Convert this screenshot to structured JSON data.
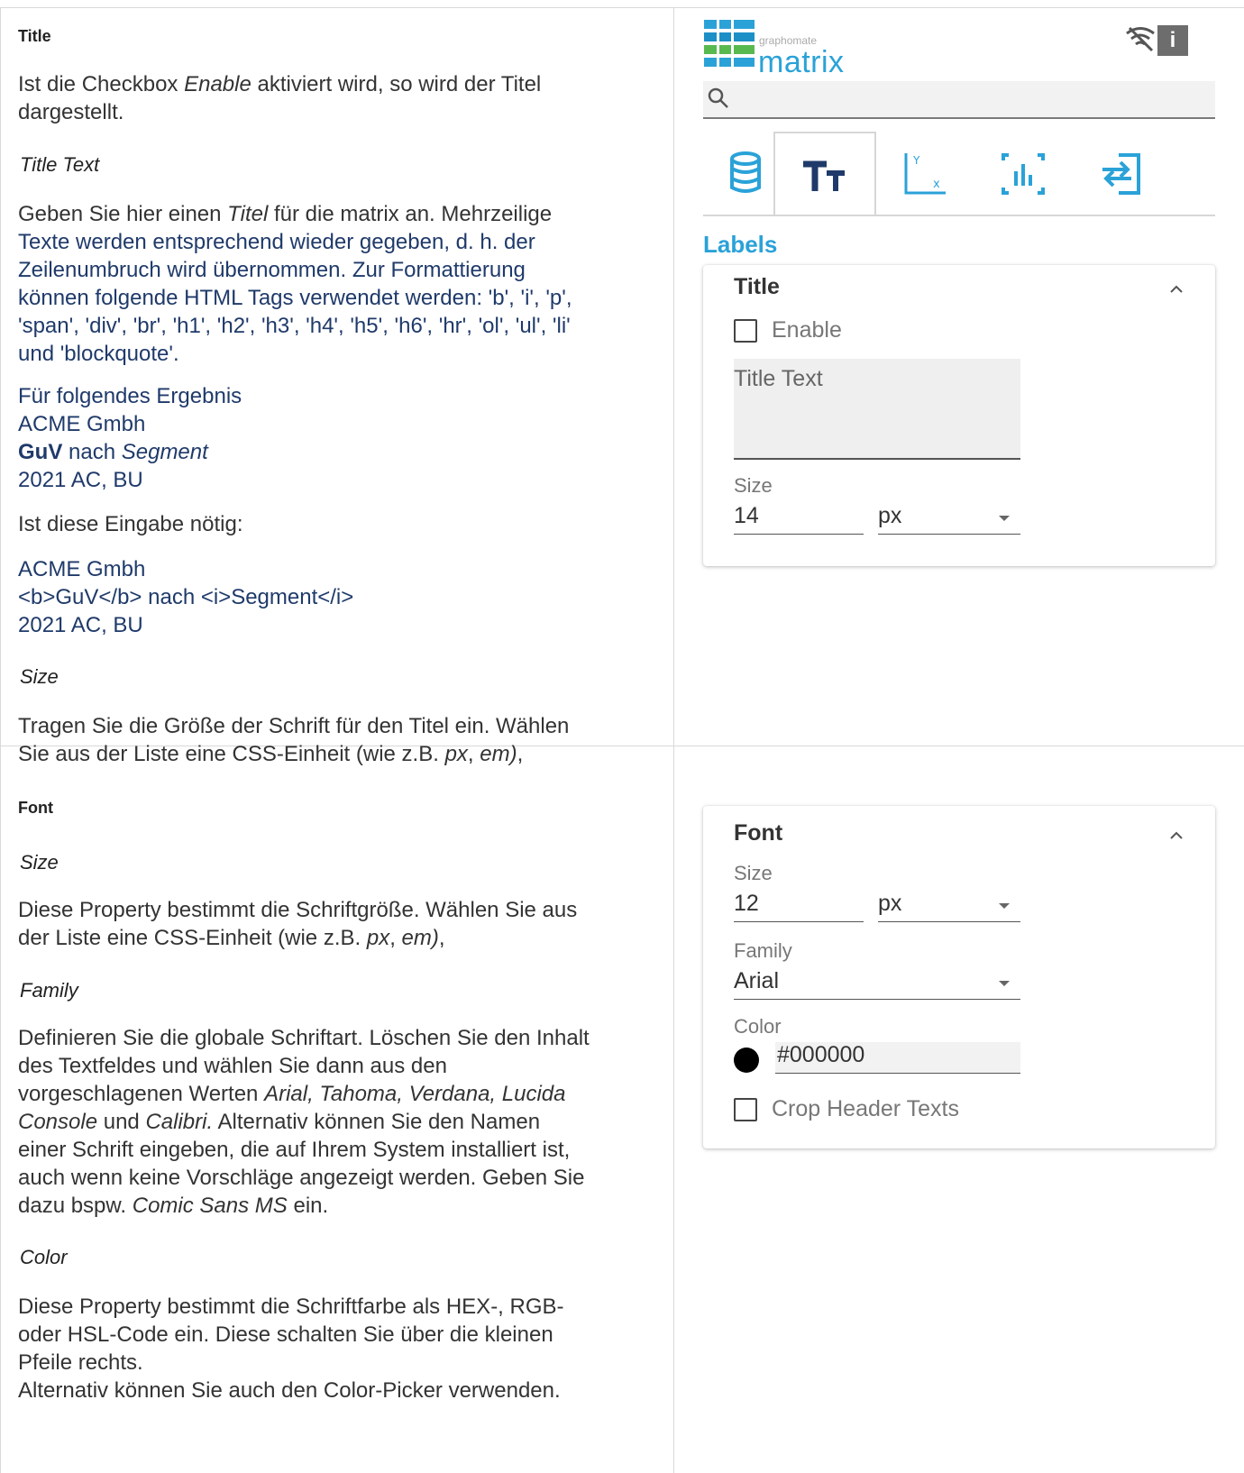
{
  "left_top": {
    "title": "Title",
    "intro": "Ist die Checkbox Enable aktiviert wird, so wird der Titel dargestellt.",
    "intro_parts": [
      "Ist die Checkbox ",
      "Enable",
      " aktiviert wird, so wird der Titel",
      "dargestellt."
    ],
    "title_text_sub": "Title Text",
    "title_text_p1": "Geben Sie hier einen ",
    "title_text_p1_em": "Titel",
    "title_text_p1_b": " für die matrix an. Mehrzeilige",
    "title_text_lines": [
      "Texte werden entsprechend wieder gegeben, d. h. der",
      "Zeilenumbruch wird übernommen. Zur Formattierung",
      "können folgende HTML Tags verwendet werden: 'b', 'i', 'p',",
      "'span', 'div', 'br', 'h1', 'h2', 'h3', 'h4', 'h5', 'h6', 'hr', 'ol', 'ul', 'li'",
      "und 'blockquote'."
    ],
    "example_lines": [
      "Für folgendes Ergebnis",
      "ACME Gmbh"
    ],
    "example_guv": "GuV",
    "example_nach": " nach ",
    "example_segment": "Segment",
    "example_year": "2021 AC, BU",
    "input_needed": "Ist diese Eingabe nötig:",
    "code_lines": [
      "ACME Gmbh",
      "<b>GuV</b> nach <i>Segment</i>",
      "2021 AC, BU"
    ],
    "size_sub": "Size",
    "size_line1": "Tragen Sie die Größe der Schrift für den Titel ein. Wählen",
    "size_line2_a": "Sie aus der Liste eine CSS-Einheit (wie z.B. ",
    "size_line2_px": "px",
    "size_line2_sep": ", ",
    "size_line2_em": "em)",
    "size_line2_end": ","
  },
  "left_bottom": {
    "title": "Font",
    "size_sub": "Size",
    "size_line1": "Diese Property bestimmt die Schriftgröße. Wählen Sie aus",
    "size_line2_a": "der Liste eine CSS-Einheit (wie z.B. ",
    "size_line2_px": "px",
    "size_line2_sep": ", ",
    "size_line2_em": "em)",
    "size_line2_end": ",",
    "family_sub": "Family",
    "family_line1": "Definieren Sie die globale Schriftart. Löschen Sie den Inhalt",
    "family_line2": "des Textfeldes und wählen Sie dann aus den",
    "family_line3_a": "vorgeschlagenen Werten ",
    "family_line3_em": "Arial, Tahoma, Verdana, Lucida",
    "family_line4_em": "Console",
    "family_line4_und": " und ",
    "family_line4_em2": "Calibri.",
    "family_line4_b": " Alternativ können Sie den Namen",
    "family_line5": "einer Schrift eingeben, die auf Ihrem System installiert ist,",
    "family_line6": "auch wenn keine Vorschläge angezeigt werden. Geben Sie",
    "family_line7_a": "dazu bspw. ",
    "family_line7_em": "Comic Sans MS",
    "family_line7_b": " ein.",
    "color_sub": "Color",
    "color_line1": "Diese Property bestimmt die Schriftfarbe als HEX-, RGB-",
    "color_line2": "oder HSL-Code ein. Diese schalten Sie über die kleinen",
    "color_line3": "Pfeile rechts.",
    "color_line4": "Alternativ können Sie auch den Color-Picker verwenden."
  },
  "panel": {
    "logo_small": "graphomate",
    "logo_big": "matrix",
    "info_label": "i",
    "search_placeholder": "",
    "tabs": [
      "database-tab",
      "text-tab",
      "axis-tab",
      "chart-tab",
      "export-tab"
    ],
    "active_tab": 1,
    "section_label": "Labels",
    "title_card": {
      "heading": "Title",
      "enable_label": "Enable",
      "enable_checked": false,
      "textarea_placeholder": "Title Text",
      "size_label": "Size",
      "size_value": "14",
      "unit_value": "px"
    },
    "font_card": {
      "heading": "Font",
      "size_label": "Size",
      "size_value": "12",
      "unit_value": "px",
      "family_label": "Family",
      "family_value": "Arial",
      "color_label": "Color",
      "color_value": "#000000",
      "crop_label": "Crop Header Texts",
      "crop_checked": false
    },
    "accent_color": "#2aa2d8"
  }
}
